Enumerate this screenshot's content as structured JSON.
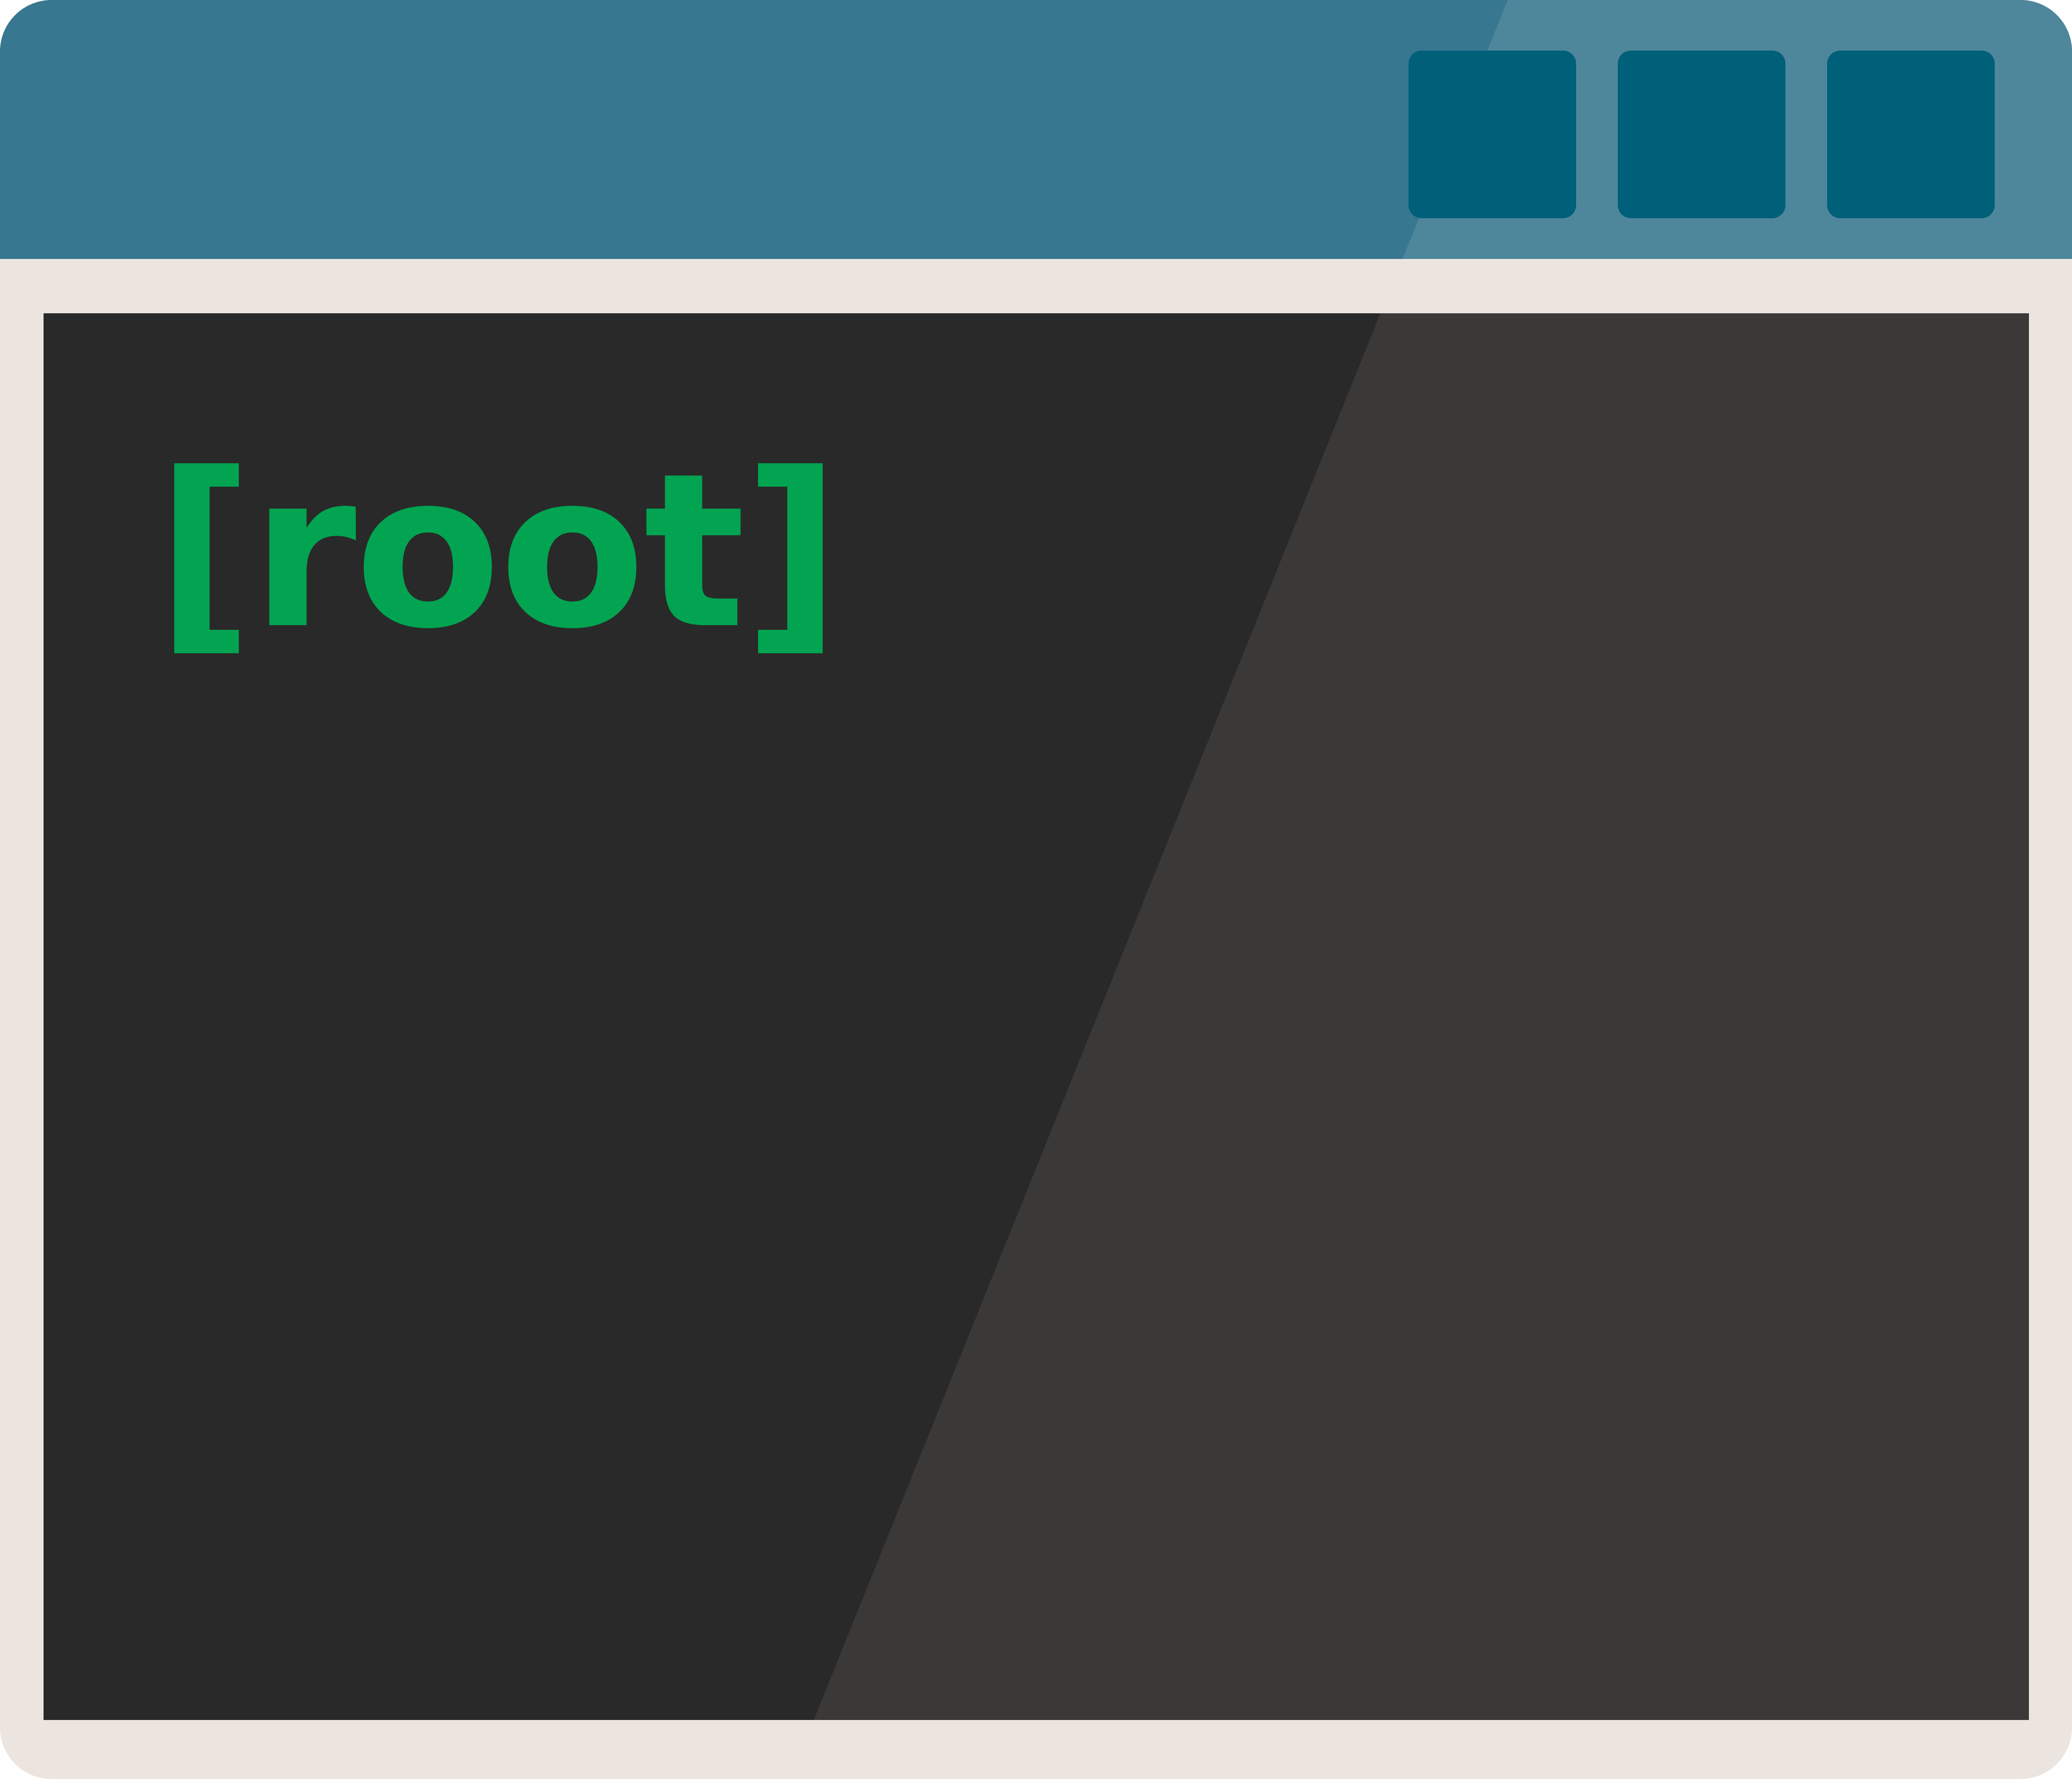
{
  "window": {
    "controls": [
      {
        "name": "window-control-1"
      },
      {
        "name": "window-control-2"
      },
      {
        "name": "window-control-3"
      }
    ]
  },
  "terminal": {
    "prompt_text": "[root]"
  },
  "colors": {
    "titlebar": "#37778f",
    "titlebar_highlight": "#4e869b",
    "window_button": "#005f79",
    "frame": "#ece5df",
    "terminal_background": "#292929",
    "terminal_highlight": "#3a3938",
    "prompt_text": "#02a451"
  }
}
